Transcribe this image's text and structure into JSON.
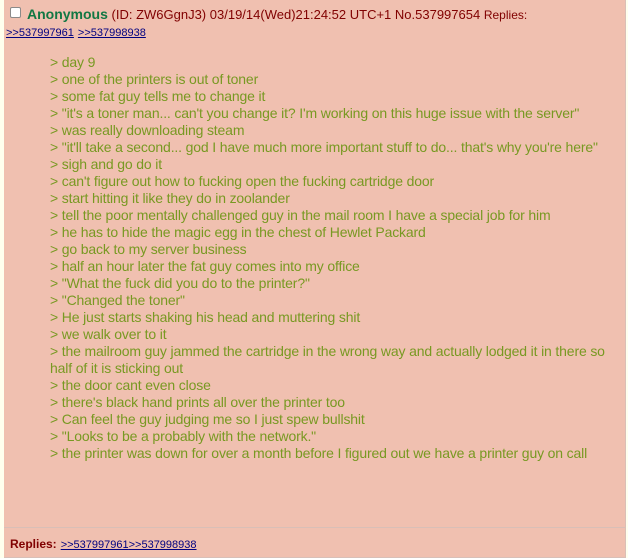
{
  "post": {
    "name": "Anonymous",
    "id_text": "(ID: ZW6GgnJ3)",
    "datetime": "03/19/14(Wed)21:24:52 UTC+1",
    "post_no": "No.537997654",
    "replies_label_header": "Replies:",
    "header_reply_links": [
      ">>537997961",
      ">>537998938"
    ],
    "body_lines": [
      "> day 9",
      "> one of the printers is out of toner",
      "> some fat guy tells me to change it",
      "> \"it's a toner man... can't you change it? I'm working on this huge issue with the server\"",
      "> was really downloading steam",
      "> \"it'll take a second... god I have much more important stuff to do... that's why you're here\"",
      "> sigh and go do it",
      "> can't figure out how to fucking open the fucking cartridge door",
      "> start hitting it like they do in zoolander",
      "> tell the poor mentally challenged guy in the mail room I have a special job for him",
      "> he has to hide the magic egg in the chest of Hewlet Packard",
      "> go back to my server business",
      "> half an hour later the fat guy comes into my office",
      "> \"What the fuck did you do to the printer?\"",
      "> \"Changed the toner\"",
      "> He just starts shaking his head and muttering shit",
      "> we walk over to it",
      "> the mailroom guy jammed the cartridge in the wrong way and actually lodged it in there so half of it is sticking out",
      "> the door cant even close",
      "> there's black hand prints all over the printer too",
      "> Can feel the guy judging me so I just spew bullshit",
      "> \"Looks to be a probably with the network.\"",
      "> the printer was down for over a month before I figured out we have a printer guy on call"
    ],
    "footer_replies_label": "Replies:",
    "footer_reply_links": [
      ">>537997961",
      ">>537998938"
    ]
  },
  "colors": {
    "post_background": "#f0c0b0",
    "name": "#117743",
    "greentext": "#789922",
    "meta": "#800000",
    "link": "#000080"
  }
}
